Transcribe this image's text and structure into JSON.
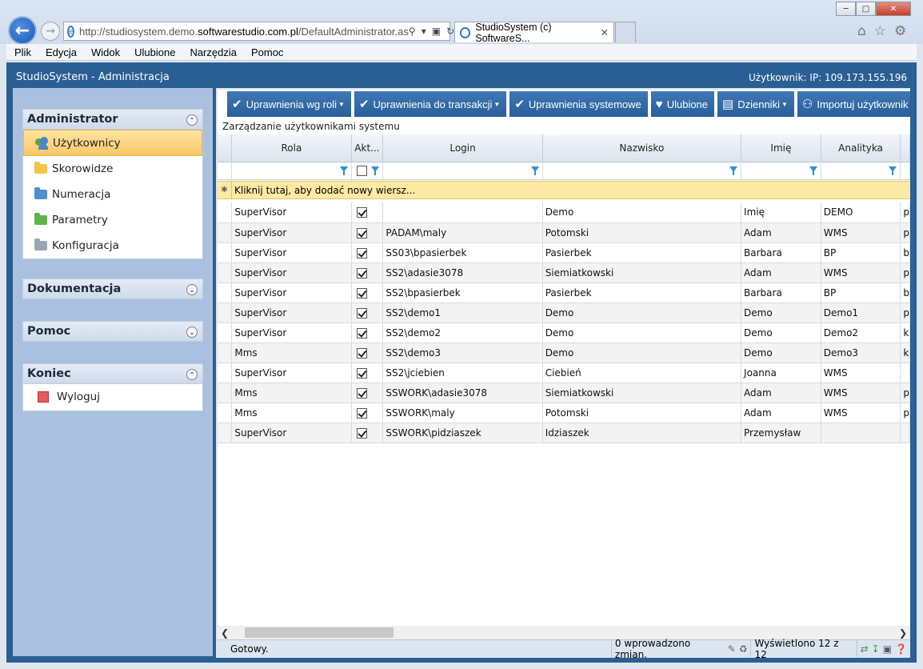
{
  "browser": {
    "url_prefix": "http://studiosystem.demo.",
    "url_domain": "softwarestudio.com.pl",
    "url_path": "/DefaultAdministrator.as",
    "tab_title": "StudioSystem (c) SoftwareS...",
    "menu": [
      "Plik",
      "Edycja",
      "Widok",
      "Ulubione",
      "Narzędzia",
      "Pomoc"
    ]
  },
  "app": {
    "title": "StudioSystem - Administracja",
    "user_info": "Użytkownik: IP: 109.173.155.196"
  },
  "sidebar": {
    "administrator": {
      "title": "Administrator",
      "items": [
        "Użytkownicy",
        "Skorowidze",
        "Numeracja",
        "Parametry",
        "Konfiguracja"
      ]
    },
    "dokumentacja": {
      "title": "Dokumentacja"
    },
    "pomoc": {
      "title": "Pomoc"
    },
    "koniec": {
      "title": "Koniec",
      "items": [
        "Wyloguj"
      ]
    }
  },
  "toolbar": {
    "buttons": [
      "Uprawnienia wg roli",
      "Uprawnienia do transakcji",
      "Uprawnienia systemowe",
      "Ulubione",
      "Dzienniki",
      "Importuj użytkownik"
    ]
  },
  "grid": {
    "title": "Zarządzanie użytkownikami systemu",
    "columns": [
      "Rola",
      "Akt...",
      "Login",
      "Nazwisko",
      "Imię",
      "Analityka"
    ],
    "new_row_text": "Kliknij tutaj, aby dodać nowy wiersz...",
    "rows": [
      {
        "rola": "SuperVisor",
        "akt": true,
        "login": "",
        "nazwisko": "Demo",
        "imie": "Imię",
        "analityka": "DEMO",
        "extra": "p"
      },
      {
        "rola": "SuperVisor",
        "akt": true,
        "login": "PADAM\\maly",
        "nazwisko": "Potomski",
        "imie": "Adam",
        "analityka": "WMS",
        "extra": "p"
      },
      {
        "rola": "SuperVisor",
        "akt": true,
        "login": "SS03\\bpasierbek",
        "nazwisko": "Pasierbek",
        "imie": "Barbara",
        "analityka": "BP",
        "extra": "b"
      },
      {
        "rola": "SuperVisor",
        "akt": true,
        "login": "SS2\\adasie3078",
        "nazwisko": "Siemiatkowski",
        "imie": "Adam",
        "analityka": "WMS",
        "extra": "p"
      },
      {
        "rola": "SuperVisor",
        "akt": true,
        "login": "SS2\\bpasierbek",
        "nazwisko": "Pasierbek",
        "imie": "Barbara",
        "analityka": "BP",
        "extra": "b"
      },
      {
        "rola": "SuperVisor",
        "akt": true,
        "login": "SS2\\demo1",
        "nazwisko": "Demo",
        "imie": "Demo",
        "analityka": "Demo1",
        "extra": "p"
      },
      {
        "rola": "SuperVisor",
        "akt": true,
        "login": "SS2\\demo2",
        "nazwisko": "Demo",
        "imie": "Demo",
        "analityka": "Demo2",
        "extra": "k"
      },
      {
        "rola": "Mms",
        "akt": true,
        "login": "SS2\\demo3",
        "nazwisko": "Demo",
        "imie": "Demo",
        "analityka": "Demo3",
        "extra": "k"
      },
      {
        "rola": "SuperVisor",
        "akt": true,
        "login": "SS2\\jciebien",
        "nazwisko": "Ciebień",
        "imie": "Joanna",
        "analityka": "WMS",
        "extra": ""
      },
      {
        "rola": "Mms",
        "akt": true,
        "login": "SSWORK\\adasie3078",
        "nazwisko": "Siemiatkowski",
        "imie": "Adam",
        "analityka": "WMS",
        "extra": "p"
      },
      {
        "rola": "Mms",
        "akt": true,
        "login": "SSWORK\\maly",
        "nazwisko": "Potomski",
        "imie": "Adam",
        "analityka": "WMS",
        "extra": "p"
      },
      {
        "rola": "SuperVisor",
        "akt": true,
        "login": "SSWORK\\pidziaszek",
        "nazwisko": "Idziaszek",
        "imie": "Przemysław",
        "analityka": "",
        "extra": ""
      }
    ]
  },
  "status": {
    "ready": "Gotowy.",
    "changes": "0 wprowadzono zmian.",
    "shown": "Wyświetlono 12 z 12"
  }
}
